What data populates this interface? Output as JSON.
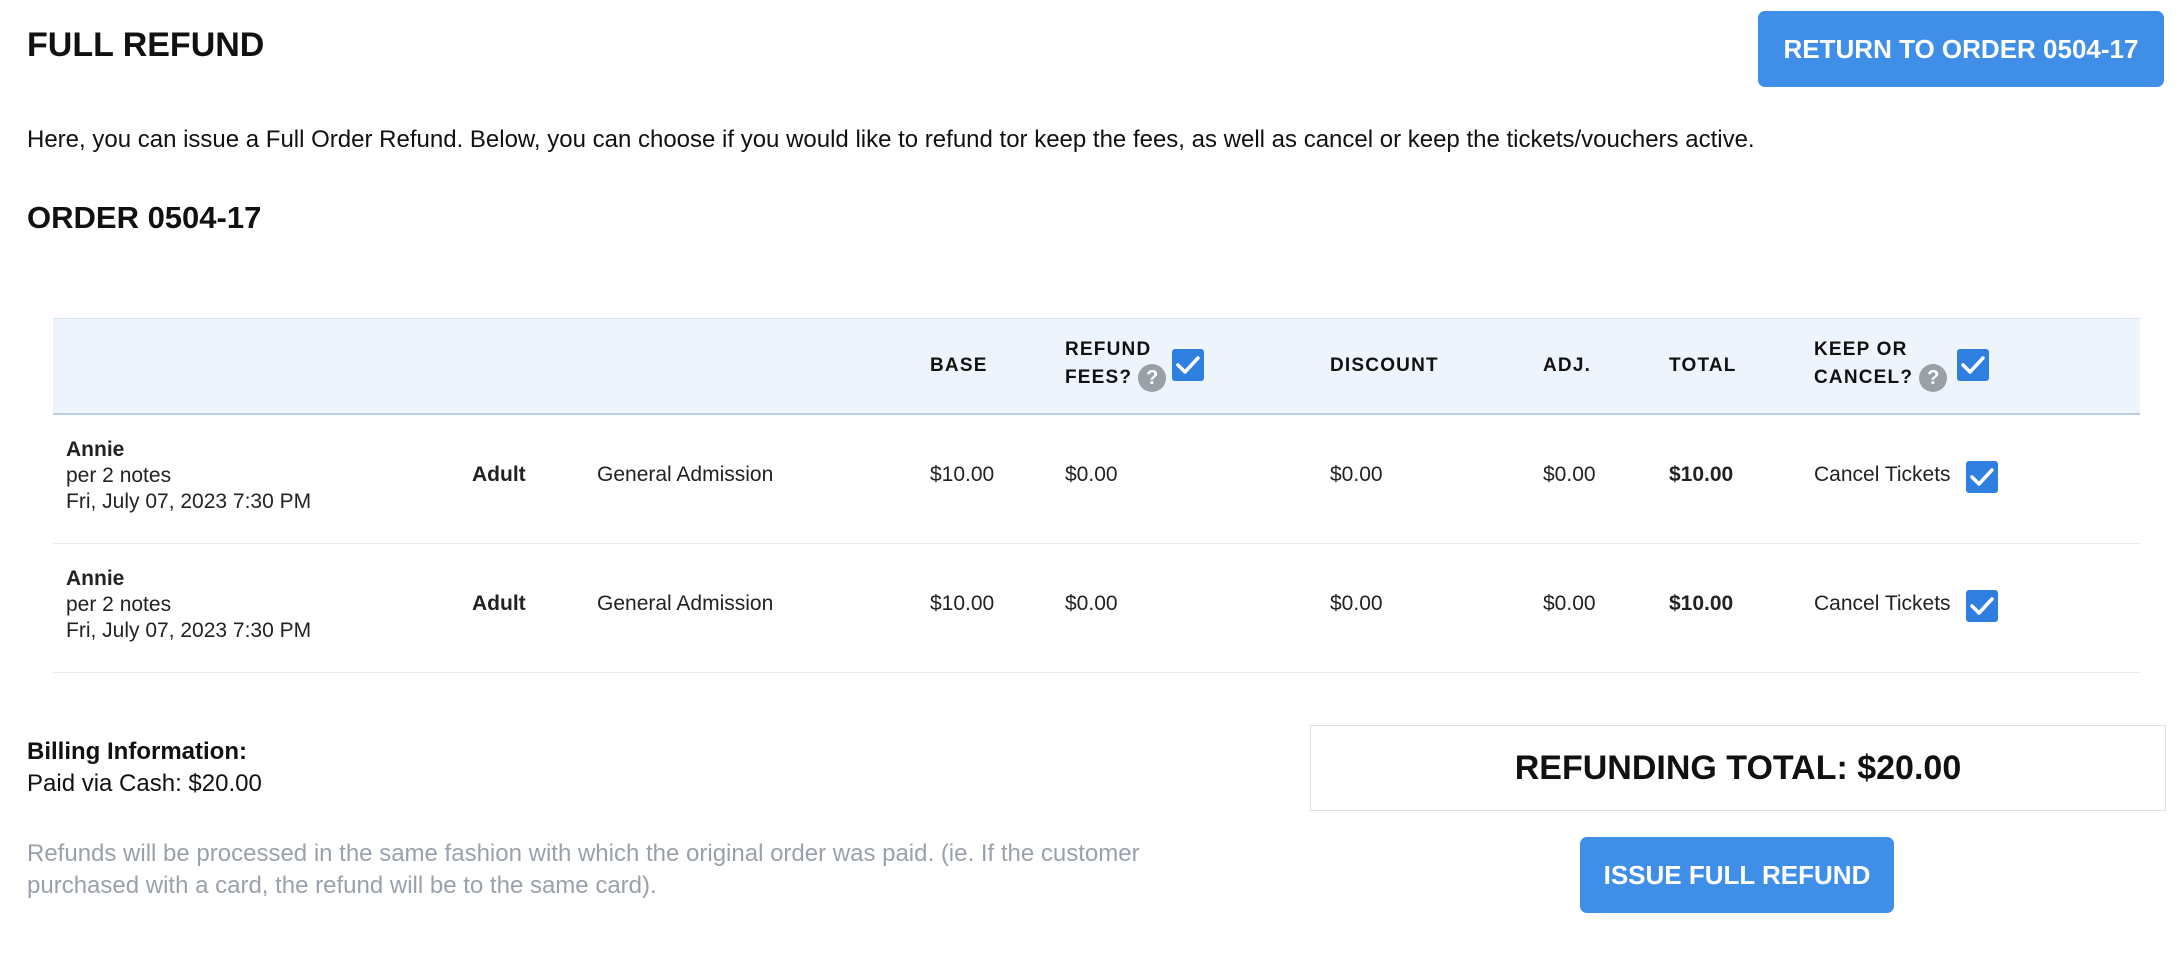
{
  "header": {
    "title": "FULL REFUND",
    "return_button": "RETURN TO ORDER 0504-17"
  },
  "intro_text": "Here, you can issue a Full Order Refund. Below, you can choose if you would like to refund tor keep the fees, as well as cancel or keep the tickets/vouchers active.",
  "order_heading": "ORDER 0504-17",
  "table": {
    "headers": {
      "base": "BASE",
      "refund_fees_line1": "REFUND",
      "refund_fees_line2": "FEES?",
      "discount": "DISCOUNT",
      "adj": "ADJ.",
      "total": "TOTAL",
      "keep_cancel_line1": "KEEP OR",
      "keep_cancel_line2": "CANCEL?",
      "help_glyph": "?"
    },
    "header_checkboxes": {
      "refund_fees_checked": true,
      "keep_cancel_checked": true
    },
    "rows": [
      {
        "name": "Annie",
        "notes": "per 2 notes",
        "datetime": "Fri, July 07, 2023 7:30 PM",
        "type": "Adult",
        "admission": "General Admission",
        "base": "$10.00",
        "fees": "$0.00",
        "discount": "$0.00",
        "adj": "$0.00",
        "total": "$10.00",
        "action": "Cancel Tickets",
        "checked": true
      },
      {
        "name": "Annie",
        "notes": "per 2 notes",
        "datetime": "Fri, July 07, 2023 7:30 PM",
        "type": "Adult",
        "admission": "General Admission",
        "base": "$10.00",
        "fees": "$0.00",
        "discount": "$0.00",
        "adj": "$0.00",
        "total": "$10.00",
        "action": "Cancel Tickets",
        "checked": true
      }
    ]
  },
  "billing": {
    "label": "Billing Information:",
    "value": "Paid via Cash: $20.00"
  },
  "refund_note": "Refunds will be processed in the same fashion with which the original order was paid. (ie. If the customer purchased with a card, the refund will be to the same card).",
  "refunding_total": "REFUNDING TOTAL: $20.00",
  "issue_button": "ISSUE FULL REFUND",
  "colors": {
    "primary": "#3f8fe8",
    "checkbox": "#2f7fe0",
    "header_bg": "#eef4fb",
    "muted_text": "#9aa1ab"
  },
  "icons": [
    "help-icon",
    "checkbox-checked-icon"
  ]
}
